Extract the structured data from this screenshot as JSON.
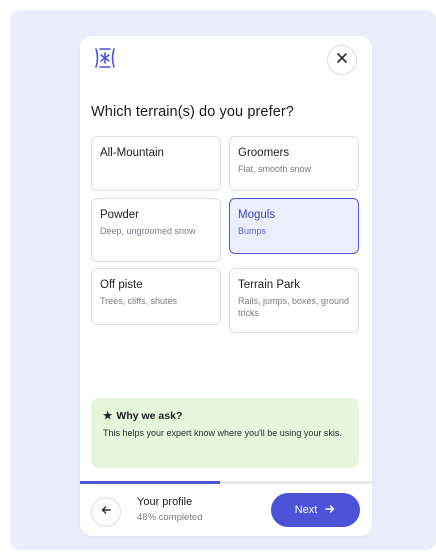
{
  "question": "Which terrain(s) do you prefer?",
  "options": [
    {
      "title": "All-Mountain",
      "subtitle": ""
    },
    {
      "title": "Groomers",
      "subtitle": "Flat, smooth snow"
    },
    {
      "title": "Powder",
      "subtitle": "Deep, ungroomed snow"
    },
    {
      "title": "Moguls",
      "subtitle": "Bumps",
      "selected": true
    },
    {
      "title": "Off piste",
      "subtitle": "Trees, cliffs, shutes"
    },
    {
      "title": "Terrain Park",
      "subtitle": "Rails, jumps, boxes, ground tricks"
    }
  ],
  "why": {
    "title": "Why we ask?",
    "text": "This helps your expert know where you'll be using your skis."
  },
  "footer": {
    "profile_title": "Your profile",
    "profile_progress_text": "48% completed",
    "progress_fraction": 0.48,
    "next_label": "Next"
  },
  "icons": {
    "logo": "brand-logo-icon",
    "close": "close-icon",
    "back": "arrow-left-icon",
    "next": "arrow-right-icon",
    "star": "star-icon"
  },
  "colors": {
    "accent": "#4b52d6",
    "selected_bg": "#eceefd",
    "info_bg": "#e6f6da",
    "backdrop": "#ebedfb"
  }
}
